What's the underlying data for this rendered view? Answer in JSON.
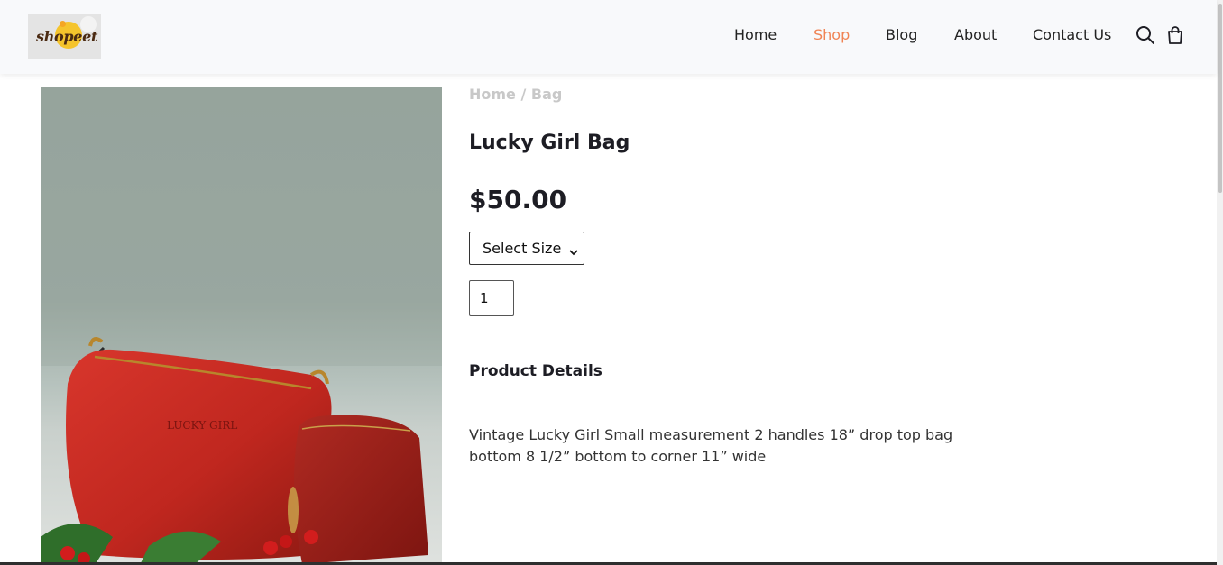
{
  "brand": {
    "logo_text": "shopeet"
  },
  "nav": {
    "items": [
      {
        "label": "Home",
        "active": false
      },
      {
        "label": "Shop",
        "active": true
      },
      {
        "label": "Blog",
        "active": false
      },
      {
        "label": "About",
        "active": false
      },
      {
        "label": "Contact Us",
        "active": false
      }
    ],
    "icons": [
      "search-icon",
      "shopping-bag-icon"
    ]
  },
  "breadcrumb": {
    "home": "Home",
    "separator": "/",
    "current": "Bag"
  },
  "product": {
    "title": "Lucky Girl Bag",
    "price": "$50.00",
    "size_select": {
      "selected": "Select Size"
    },
    "quantity": "1",
    "details_heading": "Product Details",
    "description": "Vintage Lucky Girl Small measurement 2 handles 18” drop top bag bottom 8 1/2” bottom to corner 11” wide",
    "image_alt": "Red leather shoulder bag with matching pouch",
    "image_emboss_text": "LUCKY GIRL"
  },
  "colors": {
    "accent": "#f08354",
    "text": "#1d1d24",
    "breadcrumb": "#c8c8c8",
    "header_bg": "#f8f9fb",
    "bag_red": "#c0271f"
  }
}
